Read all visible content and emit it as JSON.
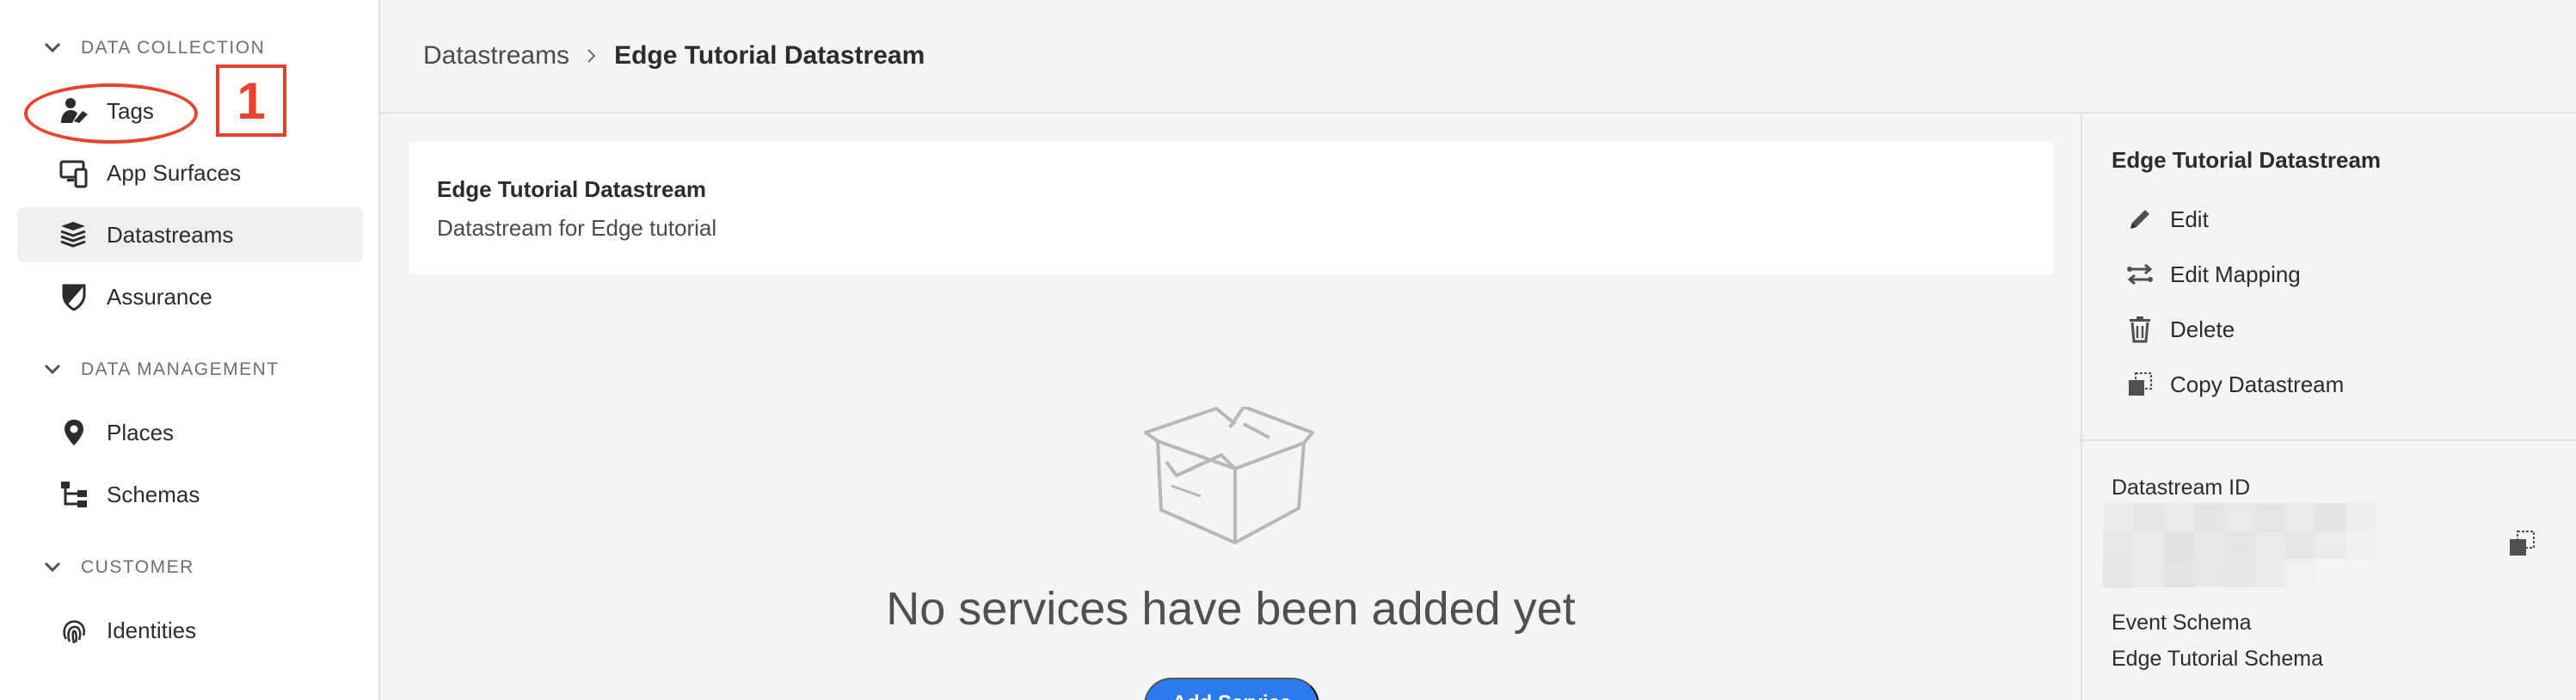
{
  "sidebar": {
    "sections": [
      {
        "label": "DATA COLLECTION"
      },
      {
        "label": "DATA MANAGEMENT"
      },
      {
        "label": "CUSTOMER"
      }
    ],
    "items": [
      {
        "label": "Tags",
        "icon": "tags-icon"
      },
      {
        "label": "App Surfaces",
        "icon": "app-surfaces-icon"
      },
      {
        "label": "Datastreams",
        "icon": "datastreams-icon",
        "active": true
      },
      {
        "label": "Assurance",
        "icon": "assurance-icon"
      },
      {
        "label": "Places",
        "icon": "places-icon"
      },
      {
        "label": "Schemas",
        "icon": "schemas-icon"
      },
      {
        "label": "Identities",
        "icon": "identities-icon"
      }
    ]
  },
  "annotation": {
    "number": "1",
    "color": "#e8432e"
  },
  "breadcrumb": {
    "parent": "Datastreams",
    "current": "Edge Tutorial Datastream"
  },
  "datastream_card": {
    "title": "Edge Tutorial Datastream",
    "description": "Datastream for Edge tutorial"
  },
  "empty_state": {
    "message": "No services have been added yet",
    "add_button_label": "Add Service",
    "icon": "empty-box-icon"
  },
  "details_panel": {
    "title": "Edge Tutorial Datastream",
    "actions": [
      {
        "label": "Edit",
        "icon": "pencil-icon"
      },
      {
        "label": "Edit Mapping",
        "icon": "mapping-icon"
      },
      {
        "label": "Delete",
        "icon": "trash-icon"
      },
      {
        "label": "Copy Datastream",
        "icon": "copy-icon"
      }
    ],
    "datastream_id_label": "Datastream ID",
    "event_schema_label": "Event Schema",
    "event_schema_value": "Edge Tutorial Schema"
  },
  "colors": {
    "accent": "#2d7bed",
    "annotation": "#e8432e",
    "background": "#f4f4f4"
  }
}
